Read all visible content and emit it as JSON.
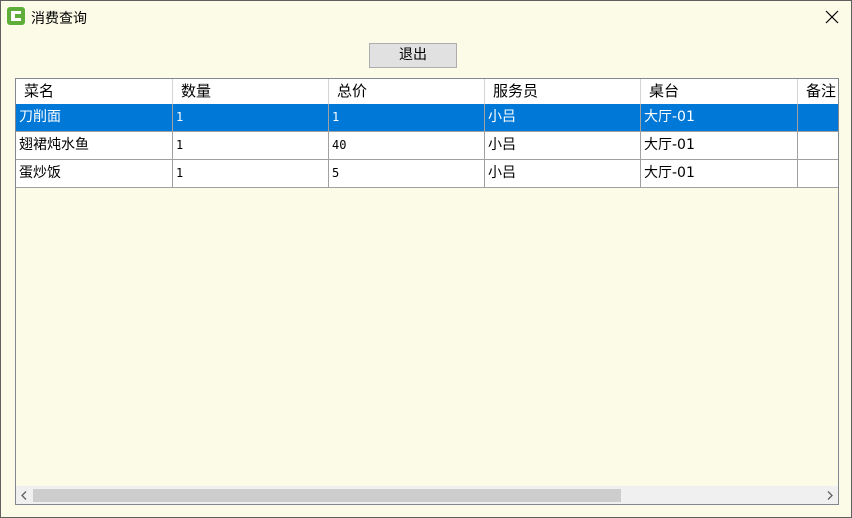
{
  "window": {
    "title": "消费查询",
    "close_icon": "close-icon",
    "app_icon": "app-icon"
  },
  "toolbar": {
    "exit_label": "退出"
  },
  "table": {
    "columns": [
      "菜名",
      "数量",
      "总价",
      "服务员",
      "桌台",
      "备注"
    ],
    "rows": [
      {
        "name": "刀削面",
        "qty": "1",
        "total": "1",
        "waiter": "小吕",
        "table": "大厅-01",
        "note": "",
        "selected": true
      },
      {
        "name": "翅裙炖水鱼",
        "qty": "1",
        "total": "40",
        "waiter": "小吕",
        "table": "大厅-01",
        "note": "",
        "selected": false
      },
      {
        "name": "蛋炒饭",
        "qty": "1",
        "total": "5",
        "waiter": "小吕",
        "table": "大厅-01",
        "note": "",
        "selected": false
      }
    ]
  },
  "colors": {
    "selection": "#0078d7",
    "window_bg": "#fcfbe8",
    "icon_green": "#5fae3a"
  }
}
